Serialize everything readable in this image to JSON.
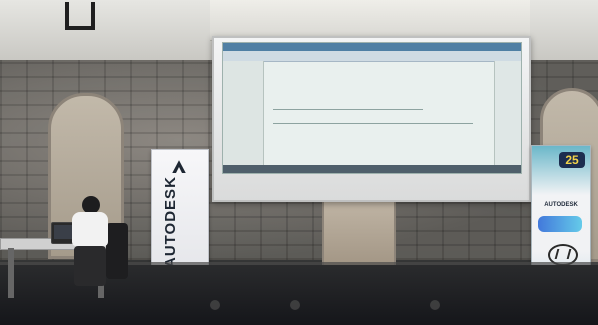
{
  "sign": {
    "left_banner_text": "AUTODESK",
    "right_badge_text": "25",
    "right_banner_text": "AUTODESK"
  },
  "icons": {
    "left_banner_logo": "autodesk-logo-icon",
    "right_banner_logo": "circle-logo-icon"
  },
  "colors": {
    "banner_text": "#1e2733",
    "badge_bg": "#1c2d4f",
    "badge_text": "#f2d34a",
    "screen_bg": "#f3f4f5"
  }
}
